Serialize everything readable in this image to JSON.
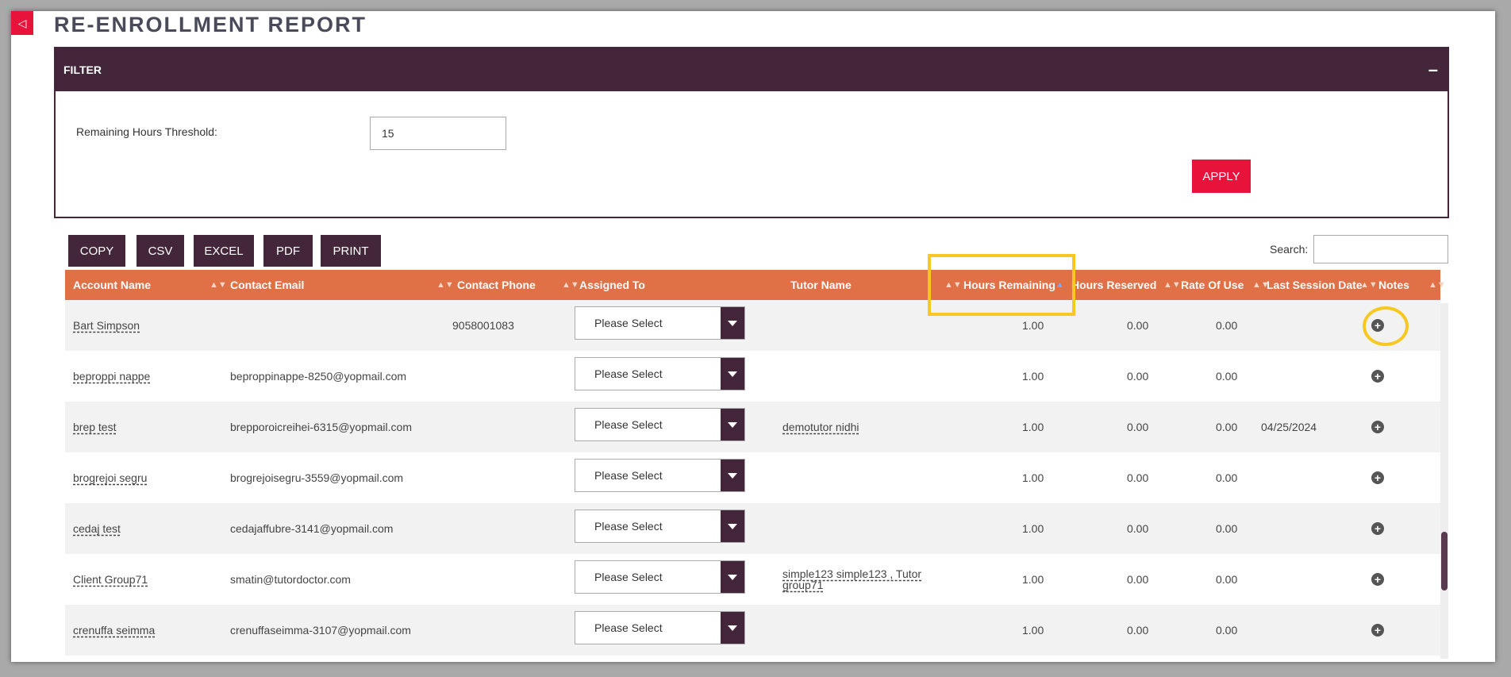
{
  "page": {
    "title": "RE-ENROLLMENT REPORT",
    "sidebar_toggle_glyph": "◁"
  },
  "filter": {
    "title": "FILTER",
    "collapse_glyph": "–",
    "threshold_label": "Remaining Hours Threshold:",
    "threshold_value": "15",
    "apply_label": "APPLY"
  },
  "toolbar": {
    "copy": "COPY",
    "csv": "CSV",
    "excel": "EXCEL",
    "pdf": "PDF",
    "print": "PRINT",
    "search_label": "Search:"
  },
  "table": {
    "columns": {
      "account_name": "Account Name",
      "contact_email": "Contact Email",
      "contact_phone": "Contact Phone",
      "assigned_to": "Assigned To",
      "tutor_name": "Tutor Name",
      "hours_remaining": "Hours Remaining",
      "hours_reserved": "Hours Reserved",
      "rate_of_use": "Rate Of Use",
      "last_session_date": "Last Session Date",
      "notes": "Notes"
    },
    "select_placeholder": "Please Select",
    "rows": [
      {
        "account": "Bart Simpson",
        "email": "",
        "phone": "9058001083",
        "tutor": "",
        "hours_remaining": "1.00",
        "hours_reserved": "0.00",
        "rate_of_use": "0.00",
        "last_session": ""
      },
      {
        "account": "beproppi nappe",
        "email": "beproppinappe-8250@yopmail.com",
        "phone": "",
        "tutor": "",
        "hours_remaining": "1.00",
        "hours_reserved": "0.00",
        "rate_of_use": "0.00",
        "last_session": ""
      },
      {
        "account": "brep test",
        "email": "brepporoicreihei-6315@yopmail.com",
        "phone": "",
        "tutor": "demotutor nidhi",
        "hours_remaining": "1.00",
        "hours_reserved": "0.00",
        "rate_of_use": "0.00",
        "last_session": "04/25/2024"
      },
      {
        "account": "brogrejoi segru",
        "email": "brogrejoisegru-3559@yopmail.com",
        "phone": "",
        "tutor": "",
        "hours_remaining": "1.00",
        "hours_reserved": "0.00",
        "rate_of_use": "0.00",
        "last_session": ""
      },
      {
        "account": "cedaj test",
        "email": "cedajaffubre-3141@yopmail.com",
        "phone": "",
        "tutor": "",
        "hours_remaining": "1.00",
        "hours_reserved": "0.00",
        "rate_of_use": "0.00",
        "last_session": ""
      },
      {
        "account": "Client Group71",
        "email": "smatin@tutordoctor.com",
        "phone": "",
        "tutor": "simple123 simple123 , Tutor group71",
        "hours_remaining": "1.00",
        "hours_reserved": "0.00",
        "rate_of_use": "0.00",
        "last_session": ""
      },
      {
        "account": "crenuffa seimma",
        "email": "crenuffaseimma-3107@yopmail.com",
        "phone": "",
        "tutor": "",
        "hours_remaining": "1.00",
        "hours_reserved": "0.00",
        "rate_of_use": "0.00",
        "last_session": ""
      }
    ]
  },
  "colors": {
    "header_purple": "#44263a",
    "table_header_orange": "#e07045",
    "accent_red": "#e8133a",
    "highlight_yellow": "#f8c822"
  }
}
